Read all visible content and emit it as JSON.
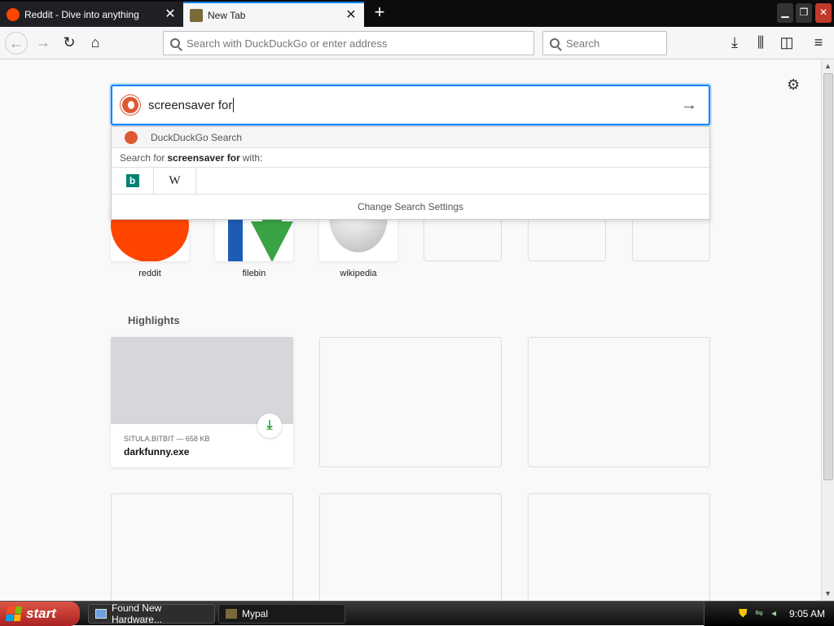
{
  "tabs": [
    {
      "title": "Reddit - Dive into anything",
      "active": false
    },
    {
      "title": "New Tab",
      "active": true
    }
  ],
  "nav": {
    "url_placeholder": "Search with DuckDuckGo or enter address",
    "search_placeholder": "Search"
  },
  "newtab": {
    "search_value": "screensaver for",
    "suggest": {
      "engine_label": "DuckDuckGo Search",
      "search_for_prefix": "Search for",
      "search_term": "screensaver for",
      "search_for_suffix": "with:",
      "engines": [
        "Bing",
        "Wikipedia"
      ],
      "wiki_glyph": "W",
      "bing_glyph": "b",
      "settings_label": "Change Search Settings"
    },
    "top_sites": [
      {
        "label": "reddit"
      },
      {
        "label": "filebin"
      },
      {
        "label": "wikipedia"
      }
    ],
    "highlights_title": "Highlights",
    "highlight": {
      "source": "SITULA.BITBIT — 658 KB",
      "filename": "darkfunny.exe"
    }
  },
  "taskbar": {
    "start_label": "start",
    "tasks": [
      {
        "label": "Found New Hardware..."
      },
      {
        "label": "Mypal"
      }
    ],
    "clock": "9:05 AM"
  },
  "colors": {
    "accent": "#0a84ff",
    "reddit": "#ff4500",
    "duckduckgo": "#de5833",
    "download_green": "#30a040"
  }
}
